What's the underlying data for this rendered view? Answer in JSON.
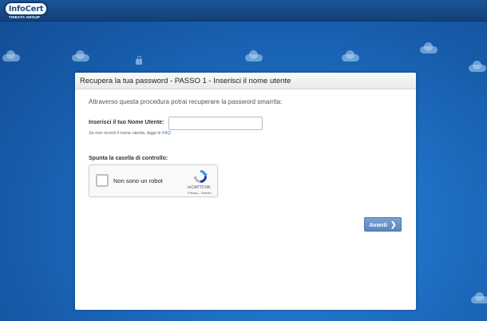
{
  "header": {
    "logo_text": "InfoCert",
    "logo_subtext": "TINEXTA GROUP"
  },
  "panel": {
    "title": "Recupera la tua password - PASSO 1 - Inserisci il nome utente",
    "intro": "Attraverso questa procedura potrai recuperare la password smarrita:",
    "username_label": "Inserisci il tuo Nome Utente:",
    "username_value": "",
    "hint_text": "Se non ricordi il nome utente, leggi le ",
    "hint_link": "FAQ",
    "checkbox_section_label": "Spunta la casella di controllo:",
    "next_label": "Avanti"
  },
  "recaptcha": {
    "label": "Non sono un robot",
    "brand": "reCAPTCHA",
    "links": "Privacy - Termini",
    "checked": false
  },
  "colors": {
    "background": "#1f6fc4",
    "topbar": "#123f78",
    "button": "#6b95c9",
    "link": "#3a7bc8"
  }
}
